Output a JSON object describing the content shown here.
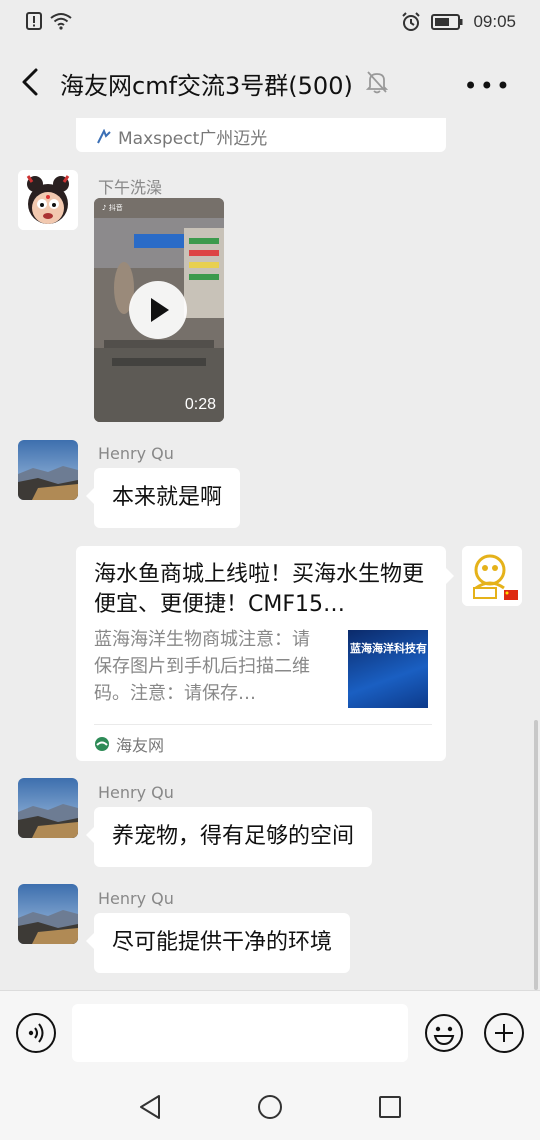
{
  "status_bar": {
    "time": "09:05"
  },
  "header": {
    "title": "海友网cmf交流3号群(500)"
  },
  "messages": {
    "prev_card_source": "Maxspect广州迈光",
    "video_msg": {
      "sender": "下午洗澡",
      "duration": "0:28"
    },
    "msg1": {
      "sender": "Henry Qu",
      "text": "本来就是啊"
    },
    "link_card": {
      "title": "海水鱼商城上线啦！买海水生物更便宜、更便捷！CMF15…",
      "description": "蓝海海洋生物商城注意：请保存图片到手机后扫描二维码。注意：请保存…",
      "thumb_text": "蓝海海洋科技有",
      "source": "海友网"
    },
    "msg2": {
      "sender": "Henry Qu",
      "text": "养宠物，得有足够的空间"
    },
    "msg3": {
      "sender": "Henry Qu",
      "text": "尽可能提供干净的环境"
    }
  },
  "icons": {
    "back": "back-arrow-icon",
    "mute": "bell-off-icon",
    "more": "more-icon",
    "voice": "voice-icon",
    "emoji": "emoji-icon",
    "plus": "plus-icon"
  }
}
